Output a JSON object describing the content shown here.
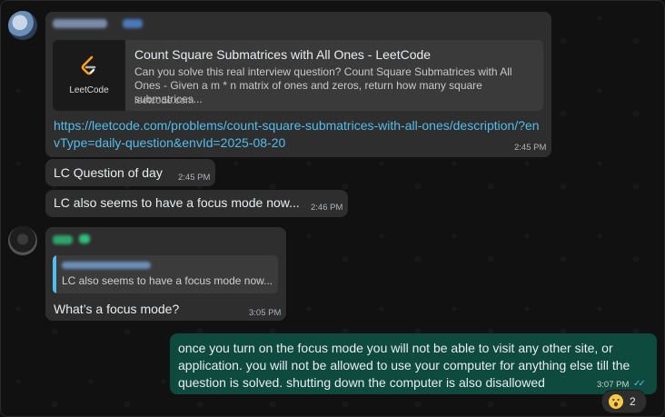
{
  "messages": {
    "msg1": {
      "link_card": {
        "thumb_label": "LeetCode",
        "title": "Count Square Submatrices with All Ones - LeetCode",
        "description": "Can you solve this real interview question? Count Square Submatrices with All Ones - Given a m * n matrix of ones and zeros, return how many square submatrices...",
        "domain": "leetcode.com"
      },
      "url": "https://leetcode.com/problems/count-square-submatrices-with-all-ones/description/?envType=daily-question&envId=2025-08-20",
      "time": "2:45 PM"
    },
    "msg2": {
      "text": "LC Question of day",
      "time": "2:45 PM"
    },
    "msg3": {
      "text": "LC also seems to have a focus mode now...",
      "time": "2:46 PM"
    },
    "msg4": {
      "quote": "LC also seems to have a focus mode now...",
      "text": "What’s a focus mode?",
      "time": "3:05 PM"
    },
    "msg5": {
      "text": "once you turn on the focus mode you will not be able to visit any other site, or application. you will not be allowed to use your computer for anything else till the question is solved. shutting down the computer is also disallowed",
      "time": "3:07 PM",
      "reaction": {
        "emoji": "😮",
        "count": "2"
      }
    }
  },
  "colors": {
    "incoming_bubble": "#2e2e2e",
    "outgoing_bubble": "#0e4a3e",
    "link": "#53bdeb",
    "leetcode_orange": "#ffa116"
  }
}
